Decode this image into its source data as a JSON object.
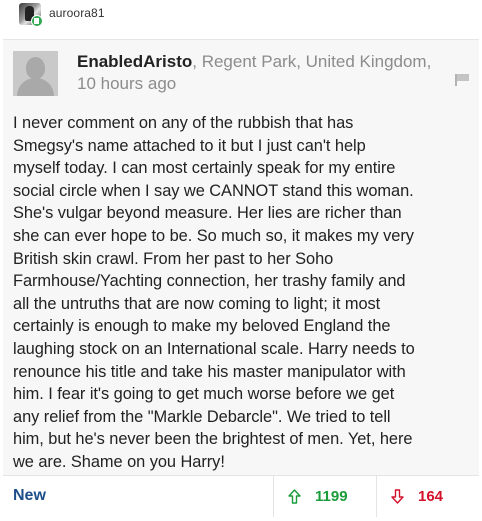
{
  "top_user": {
    "username": "auroora81"
  },
  "comment": {
    "author": "EnabledAristo",
    "location": ", Regent Park, United Kingdom,",
    "time": "10 hours ago",
    "lines": [
      "I never comment on any of the rubbish that has",
      "Smegsy's name attached to it but I just can't help",
      "myself today. I can most certainly speak for my entire",
      "social circle when I say we CANNOT stand this woman.",
      "She's vulgar beyond measure. Her lies are richer than",
      "she can ever hope to be. So much so, it makes my very",
      "British skin crawl. From her past to her Soho",
      "Farmhouse/Yachting connection, her trashy family and",
      "all the untruths that are now coming to light; it most",
      "certainly is enough to make my beloved England the",
      "laughing stock on an International scale. Harry needs to",
      "renounce his title and take his master manipulator with",
      "him. I fear it's going to get much worse before we get",
      "any relief from the \"Markle Debarcle\". We tried to tell",
      "him, but he's never been the brightest of men. Yet, here",
      "we are. Shame on you Harry!"
    ]
  },
  "footer": {
    "sort_label": "New",
    "upvotes": "1199",
    "downvotes": "164"
  },
  "colors": {
    "card_bg": "#f7f7f7",
    "link_blue": "#1c4f8a",
    "upvote_green": "#1a9c3a",
    "downvote_red": "#d3122a",
    "badge_green": "#2fa84f"
  },
  "icons": {
    "top_avatar": "user-avatar-photo",
    "badge": "badge-icon",
    "author_avatar": "default-avatar-icon",
    "flag": "flag-report-icon",
    "upvote": "arrow-up-icon",
    "downvote": "arrow-down-icon"
  }
}
